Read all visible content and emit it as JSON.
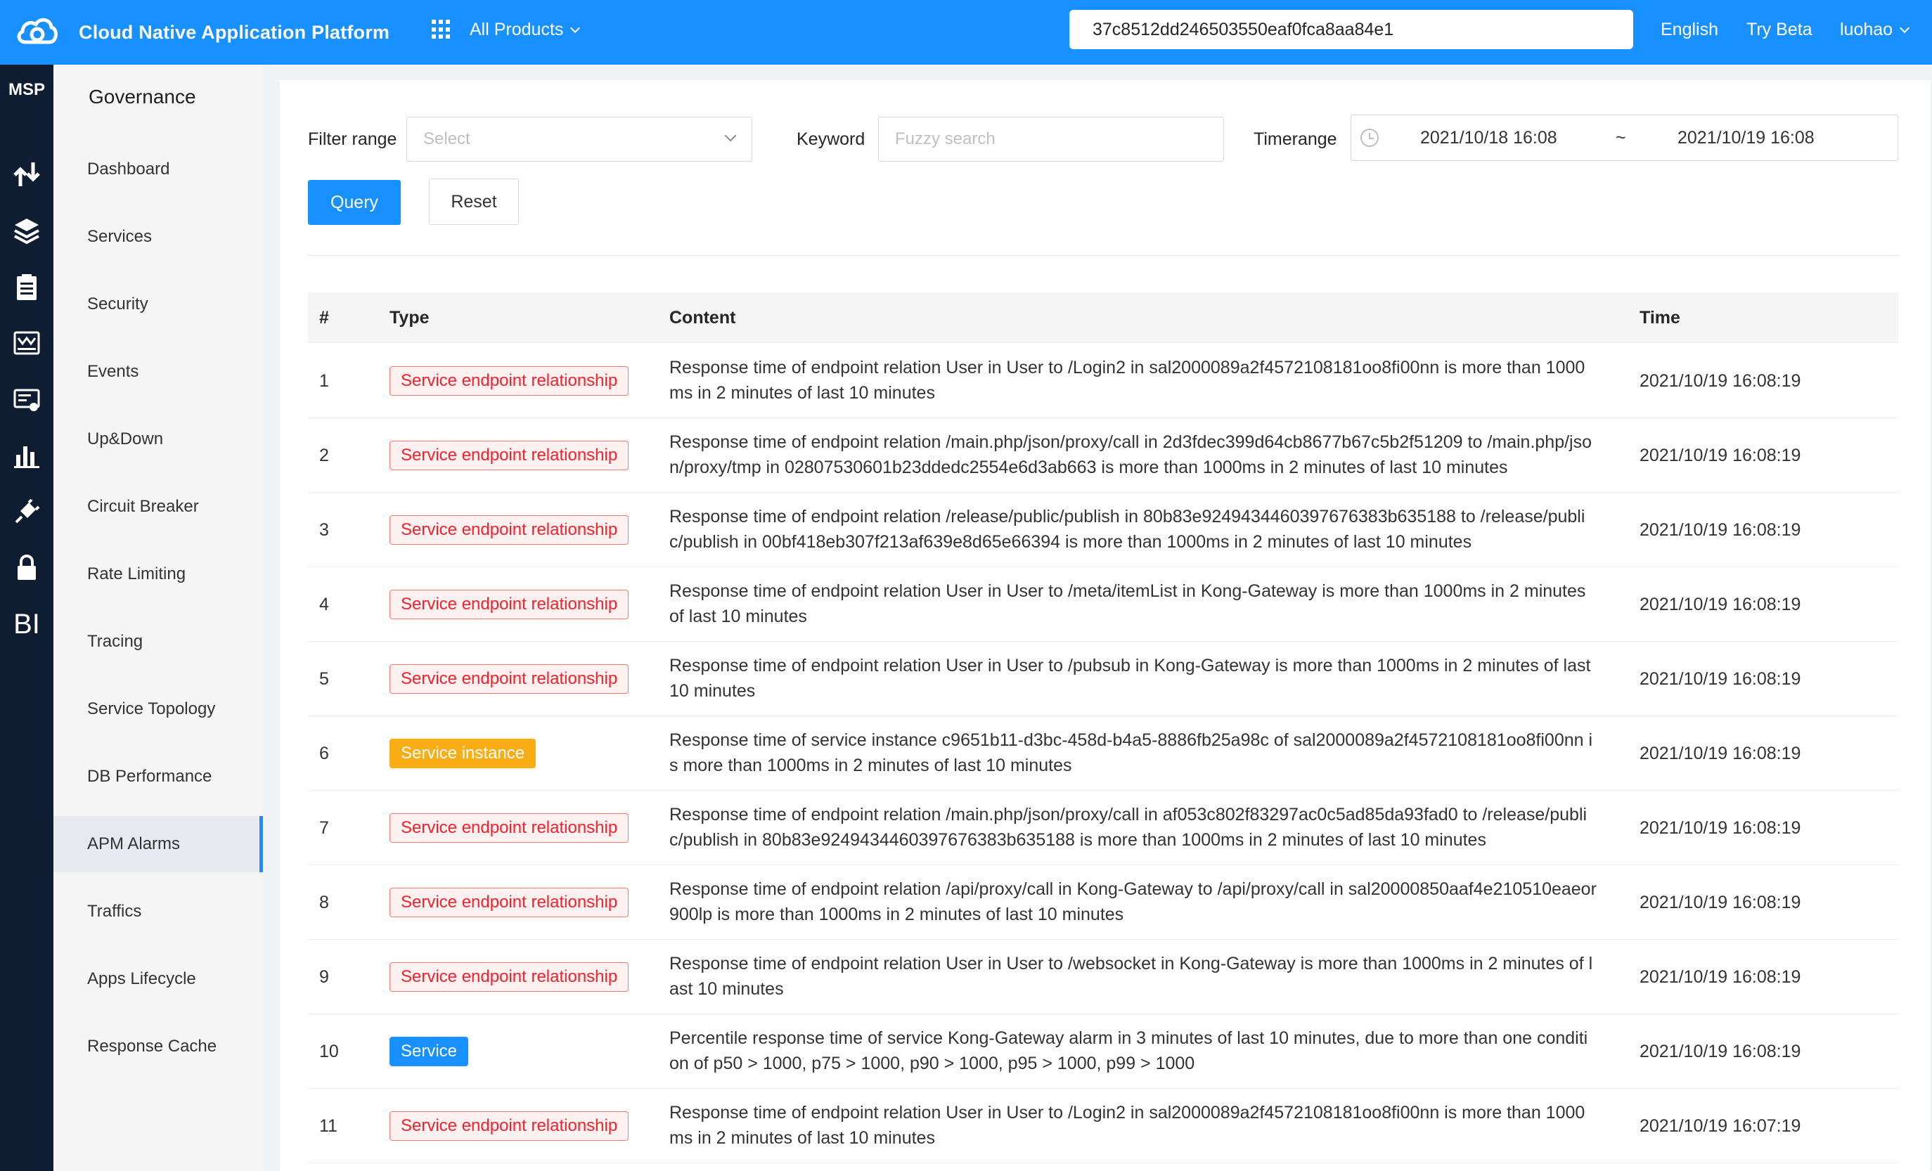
{
  "header": {
    "brand": "Cloud Native Application Platform",
    "all_products": "All Products",
    "search_value": "37c8512dd246503550eaf0fca8aa84e1",
    "lang": "English",
    "try_beta": "Try Beta",
    "user": "luohao"
  },
  "rail": {
    "title": "MSP",
    "icons": [
      "arrows-updown-icon",
      "layers-icon",
      "clipboard-icon",
      "monitor-chart-icon",
      "config-card-icon",
      "bar-chart-icon",
      "plug-icon",
      "lock-icon"
    ],
    "bi_label": "BI"
  },
  "sidebar": {
    "title": "Governance",
    "items": [
      {
        "label": "Dashboard"
      },
      {
        "label": "Services"
      },
      {
        "label": "Security"
      },
      {
        "label": "Events"
      },
      {
        "label": "Up&Down"
      },
      {
        "label": "Circuit Breaker"
      },
      {
        "label": "Rate Limiting"
      },
      {
        "label": "Tracing"
      },
      {
        "label": "Service Topology"
      },
      {
        "label": "DB Performance"
      },
      {
        "label": "APM Alarms"
      },
      {
        "label": "Traffics"
      },
      {
        "label": "Apps Lifecycle"
      },
      {
        "label": "Response Cache"
      }
    ],
    "active_index": 10
  },
  "filters": {
    "filter_range_label": "Filter range",
    "filter_range_placeholder": "Select",
    "keyword_label": "Keyword",
    "keyword_placeholder": "Fuzzy search",
    "timerange_label": "Timerange",
    "time_start": "2021/10/18 16:08",
    "time_sep": "~",
    "time_end": "2021/10/19 16:08",
    "query_label": "Query",
    "reset_label": "Reset"
  },
  "table": {
    "columns": {
      "idx": "#",
      "type": "Type",
      "content": "Content",
      "time": "Time"
    },
    "rows": [
      {
        "idx": "1",
        "type": "Service endpoint relationship",
        "tag": "red",
        "content": "Response time of endpoint relation User in User to /Login2 in sal2000089a2f4572108181oo8fi00nn is more than 1000ms in 2 minutes of last 10 minutes",
        "time": "2021/10/19 16:08:19"
      },
      {
        "idx": "2",
        "type": "Service endpoint relationship",
        "tag": "red",
        "content": "Response time of endpoint relation /main.php/json/proxy/call in 2d3fdec399d64cb8677b67c5b2f51209 to /main.php/json/proxy/tmp in 02807530601b23ddedc2554e6d3ab663 is more than 1000ms in 2 minutes of last 10 minutes",
        "time": "2021/10/19 16:08:19"
      },
      {
        "idx": "3",
        "type": "Service endpoint relationship",
        "tag": "red",
        "content": "Response time of endpoint relation /release/public/publish in 80b83e9249434460397676383b635188 to /release/public/publish in 00bf418eb307f213af639e8d65e66394 is more than 1000ms in 2 minutes of last 10 minutes",
        "time": "2021/10/19 16:08:19"
      },
      {
        "idx": "4",
        "type": "Service endpoint relationship",
        "tag": "red",
        "content": "Response time of endpoint relation User in User to /meta/itemList in Kong-Gateway is more than 1000ms in 2 minutes of last 10 minutes",
        "time": "2021/10/19 16:08:19"
      },
      {
        "idx": "5",
        "type": "Service endpoint relationship",
        "tag": "red",
        "content": "Response time of endpoint relation User in User to /pubsub in Kong-Gateway is more than 1000ms in 2 minutes of last 10 minutes",
        "time": "2021/10/19 16:08:19"
      },
      {
        "idx": "6",
        "type": "Service instance",
        "tag": "orange",
        "content": "Response time of service instance c9651b11-d3bc-458d-b4a5-8886fb25a98c of sal2000089a2f4572108181oo8fi00nn is more than 1000ms in 2 minutes of last 10 minutes",
        "time": "2021/10/19 16:08:19"
      },
      {
        "idx": "7",
        "type": "Service endpoint relationship",
        "tag": "red",
        "content": "Response time of endpoint relation /main.php/json/proxy/call in af053c802f83297ac0c5ad85da93fad0 to /release/public/publish in 80b83e9249434460397676383b635188 is more than 1000ms in 2 minutes of last 10 minutes",
        "time": "2021/10/19 16:08:19"
      },
      {
        "idx": "8",
        "type": "Service endpoint relationship",
        "tag": "red",
        "content": "Response time of endpoint relation /api/proxy/call in Kong-Gateway to /api/proxy/call in sal20000850aaf4e210510eaeor900lp is more than 1000ms in 2 minutes of last 10 minutes",
        "time": "2021/10/19 16:08:19"
      },
      {
        "idx": "9",
        "type": "Service endpoint relationship",
        "tag": "red",
        "content": "Response time of endpoint relation User in User to /websocket in Kong-Gateway is more than 1000ms in 2 minutes of last 10 minutes",
        "time": "2021/10/19 16:08:19"
      },
      {
        "idx": "10",
        "type": "Service",
        "tag": "blue",
        "content": "Percentile response time of service Kong-Gateway alarm in 3 minutes of last 10 minutes, due to more than one condition of p50 > 1000, p75 > 1000, p90 > 1000, p95 > 1000, p99 > 1000",
        "time": "2021/10/19 16:08:19"
      },
      {
        "idx": "11",
        "type": "Service endpoint relationship",
        "tag": "red",
        "content": "Response time of endpoint relation User in User to /Login2 in sal2000089a2f4572108181oo8fi00nn is more than 1000ms in 2 minutes of last 10 minutes",
        "time": "2021/10/19 16:07:19"
      }
    ]
  },
  "colors": {
    "primary": "#1890ff",
    "rail": "#0f1d33",
    "tag_red": "#f5222d",
    "tag_orange": "#faad14"
  }
}
